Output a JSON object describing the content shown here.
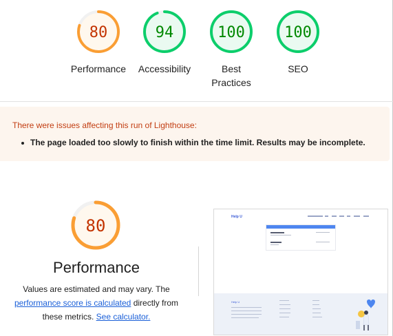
{
  "scores": [
    {
      "label": "Performance",
      "score": "80",
      "value": 0.8,
      "status": "average"
    },
    {
      "label": "Accessibility",
      "score": "94",
      "value": 0.94,
      "status": "pass"
    },
    {
      "label": "Best Practices",
      "score": "100",
      "value": 1.0,
      "status": "pass"
    },
    {
      "label": "SEO",
      "score": "100",
      "value": 1.0,
      "status": "pass"
    }
  ],
  "colors": {
    "average_stroke": "#fa9e34",
    "average_text": "#c33300",
    "average_fill": "#fff8ee",
    "pass_stroke": "#0cce6b",
    "pass_text": "#008800",
    "pass_fill": "#eafaf1",
    "track": "#f1f1f1",
    "warning_bg": "#fdf5ee",
    "warning_text": "#c23d11",
    "link": "#1a5fd8"
  },
  "warnings": {
    "title": "There were issues affecting this run of Lighthouse:",
    "items": [
      "The page loaded too slowly to finish within the time limit. Results may be incomplete."
    ]
  },
  "performance": {
    "score": "80",
    "value": 0.8,
    "title": "Performance",
    "desc_line1": "Values are estimated and may vary. The",
    "link_text": "performance score is calculated",
    "desc_line2_rest": " directly from",
    "desc_line3_prefix": "these metrics. ",
    "calculator_link": "See calculator."
  },
  "screenshot": {
    "logo": "Help U",
    "footer_title": "Help U"
  }
}
